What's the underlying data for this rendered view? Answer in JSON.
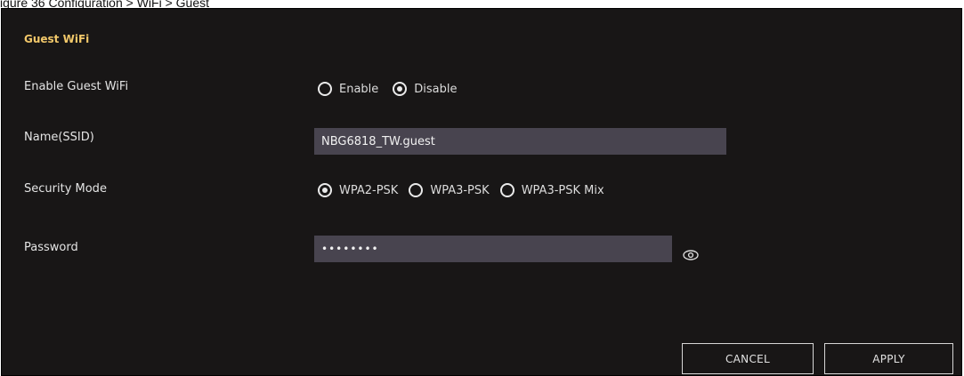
{
  "caption": "igure 36 Configuration > WiFi > Guest",
  "section": {
    "title": "Guest WiFi"
  },
  "enable_guest_wifi": {
    "label": "Enable Guest WiFi",
    "options": [
      {
        "label": "Enable",
        "checked": false
      },
      {
        "label": "Disable",
        "checked": true
      }
    ]
  },
  "ssid": {
    "label": "Name(SSID)",
    "value": "NBG6818_TW.guest"
  },
  "security_mode": {
    "label": "Security Mode",
    "options": [
      {
        "label": "WPA2-PSK",
        "checked": true
      },
      {
        "label": "WPA3-PSK",
        "checked": false
      },
      {
        "label": "WPA3-PSK Mix",
        "checked": false
      }
    ]
  },
  "password": {
    "label": "Password",
    "value": "••••••••",
    "toggle_icon": "eye-icon"
  },
  "buttons": {
    "cancel": "CANCEL",
    "apply": "APPLY"
  },
  "colors": {
    "panel_background": "#181616",
    "section_title": "#f2c86a",
    "input_background": "#48444f"
  }
}
